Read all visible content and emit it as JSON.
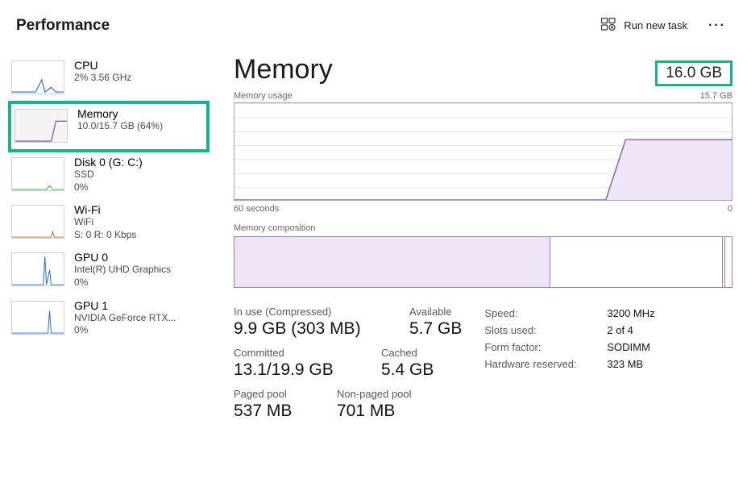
{
  "header": {
    "title": "Performance",
    "run_task_label": "Run new task"
  },
  "sidebar": {
    "items": [
      {
        "title": "CPU",
        "sub1": "2%  3.56 GHz",
        "sub2": ""
      },
      {
        "title": "Memory",
        "sub1": "10.0/15.7 GB (64%)",
        "sub2": ""
      },
      {
        "title": "Disk 0 (G: C:)",
        "sub1": "SSD",
        "sub2": "0%"
      },
      {
        "title": "Wi-Fi",
        "sub1": "WiFi",
        "sub2": "S: 0 R: 0 Kbps"
      },
      {
        "title": "GPU 0",
        "sub1": "Intel(R) UHD Graphics",
        "sub2": "0%"
      },
      {
        "title": "GPU 1",
        "sub1": "NVIDIA GeForce RTX...",
        "sub2": "0%"
      }
    ],
    "selected_index": 1
  },
  "main": {
    "title": "Memory",
    "capacity": "16.0 GB",
    "usage_chart": {
      "label": "Memory usage",
      "max_label": "15.7 GB",
      "x_left": "60 seconds",
      "x_right": "0"
    },
    "composition_label": "Memory composition",
    "stats": {
      "in_use_label": "In use (Compressed)",
      "in_use_value": "9.9 GB (303 MB)",
      "available_label": "Available",
      "available_value": "5.7 GB",
      "committed_label": "Committed",
      "committed_value": "13.1/19.9 GB",
      "cached_label": "Cached",
      "cached_value": "5.4 GB",
      "paged_label": "Paged pool",
      "paged_value": "537 MB",
      "nonpaged_label": "Non-paged pool",
      "nonpaged_value": "701 MB"
    },
    "hw": [
      {
        "key": "Speed:",
        "val": "3200 MHz"
      },
      {
        "key": "Slots used:",
        "val": "2 of 4"
      },
      {
        "key": "Form factor:",
        "val": "SODIMM"
      },
      {
        "key": "Hardware reserved:",
        "val": "323 MB"
      }
    ]
  },
  "chart_data": {
    "type": "line",
    "title": "Memory usage",
    "xlabel": "seconds ago",
    "ylabel": "GB",
    "ylim": [
      0,
      15.7
    ],
    "xlim": [
      60,
      0
    ],
    "x": [
      60,
      14,
      12,
      0
    ],
    "values": [
      0,
      0,
      10.0,
      10.0
    ]
  },
  "colors": {
    "accent_purple": "#8a5eb0",
    "accent_purple_fill": "#efe4f5",
    "highlight_teal": "#18b28f"
  }
}
